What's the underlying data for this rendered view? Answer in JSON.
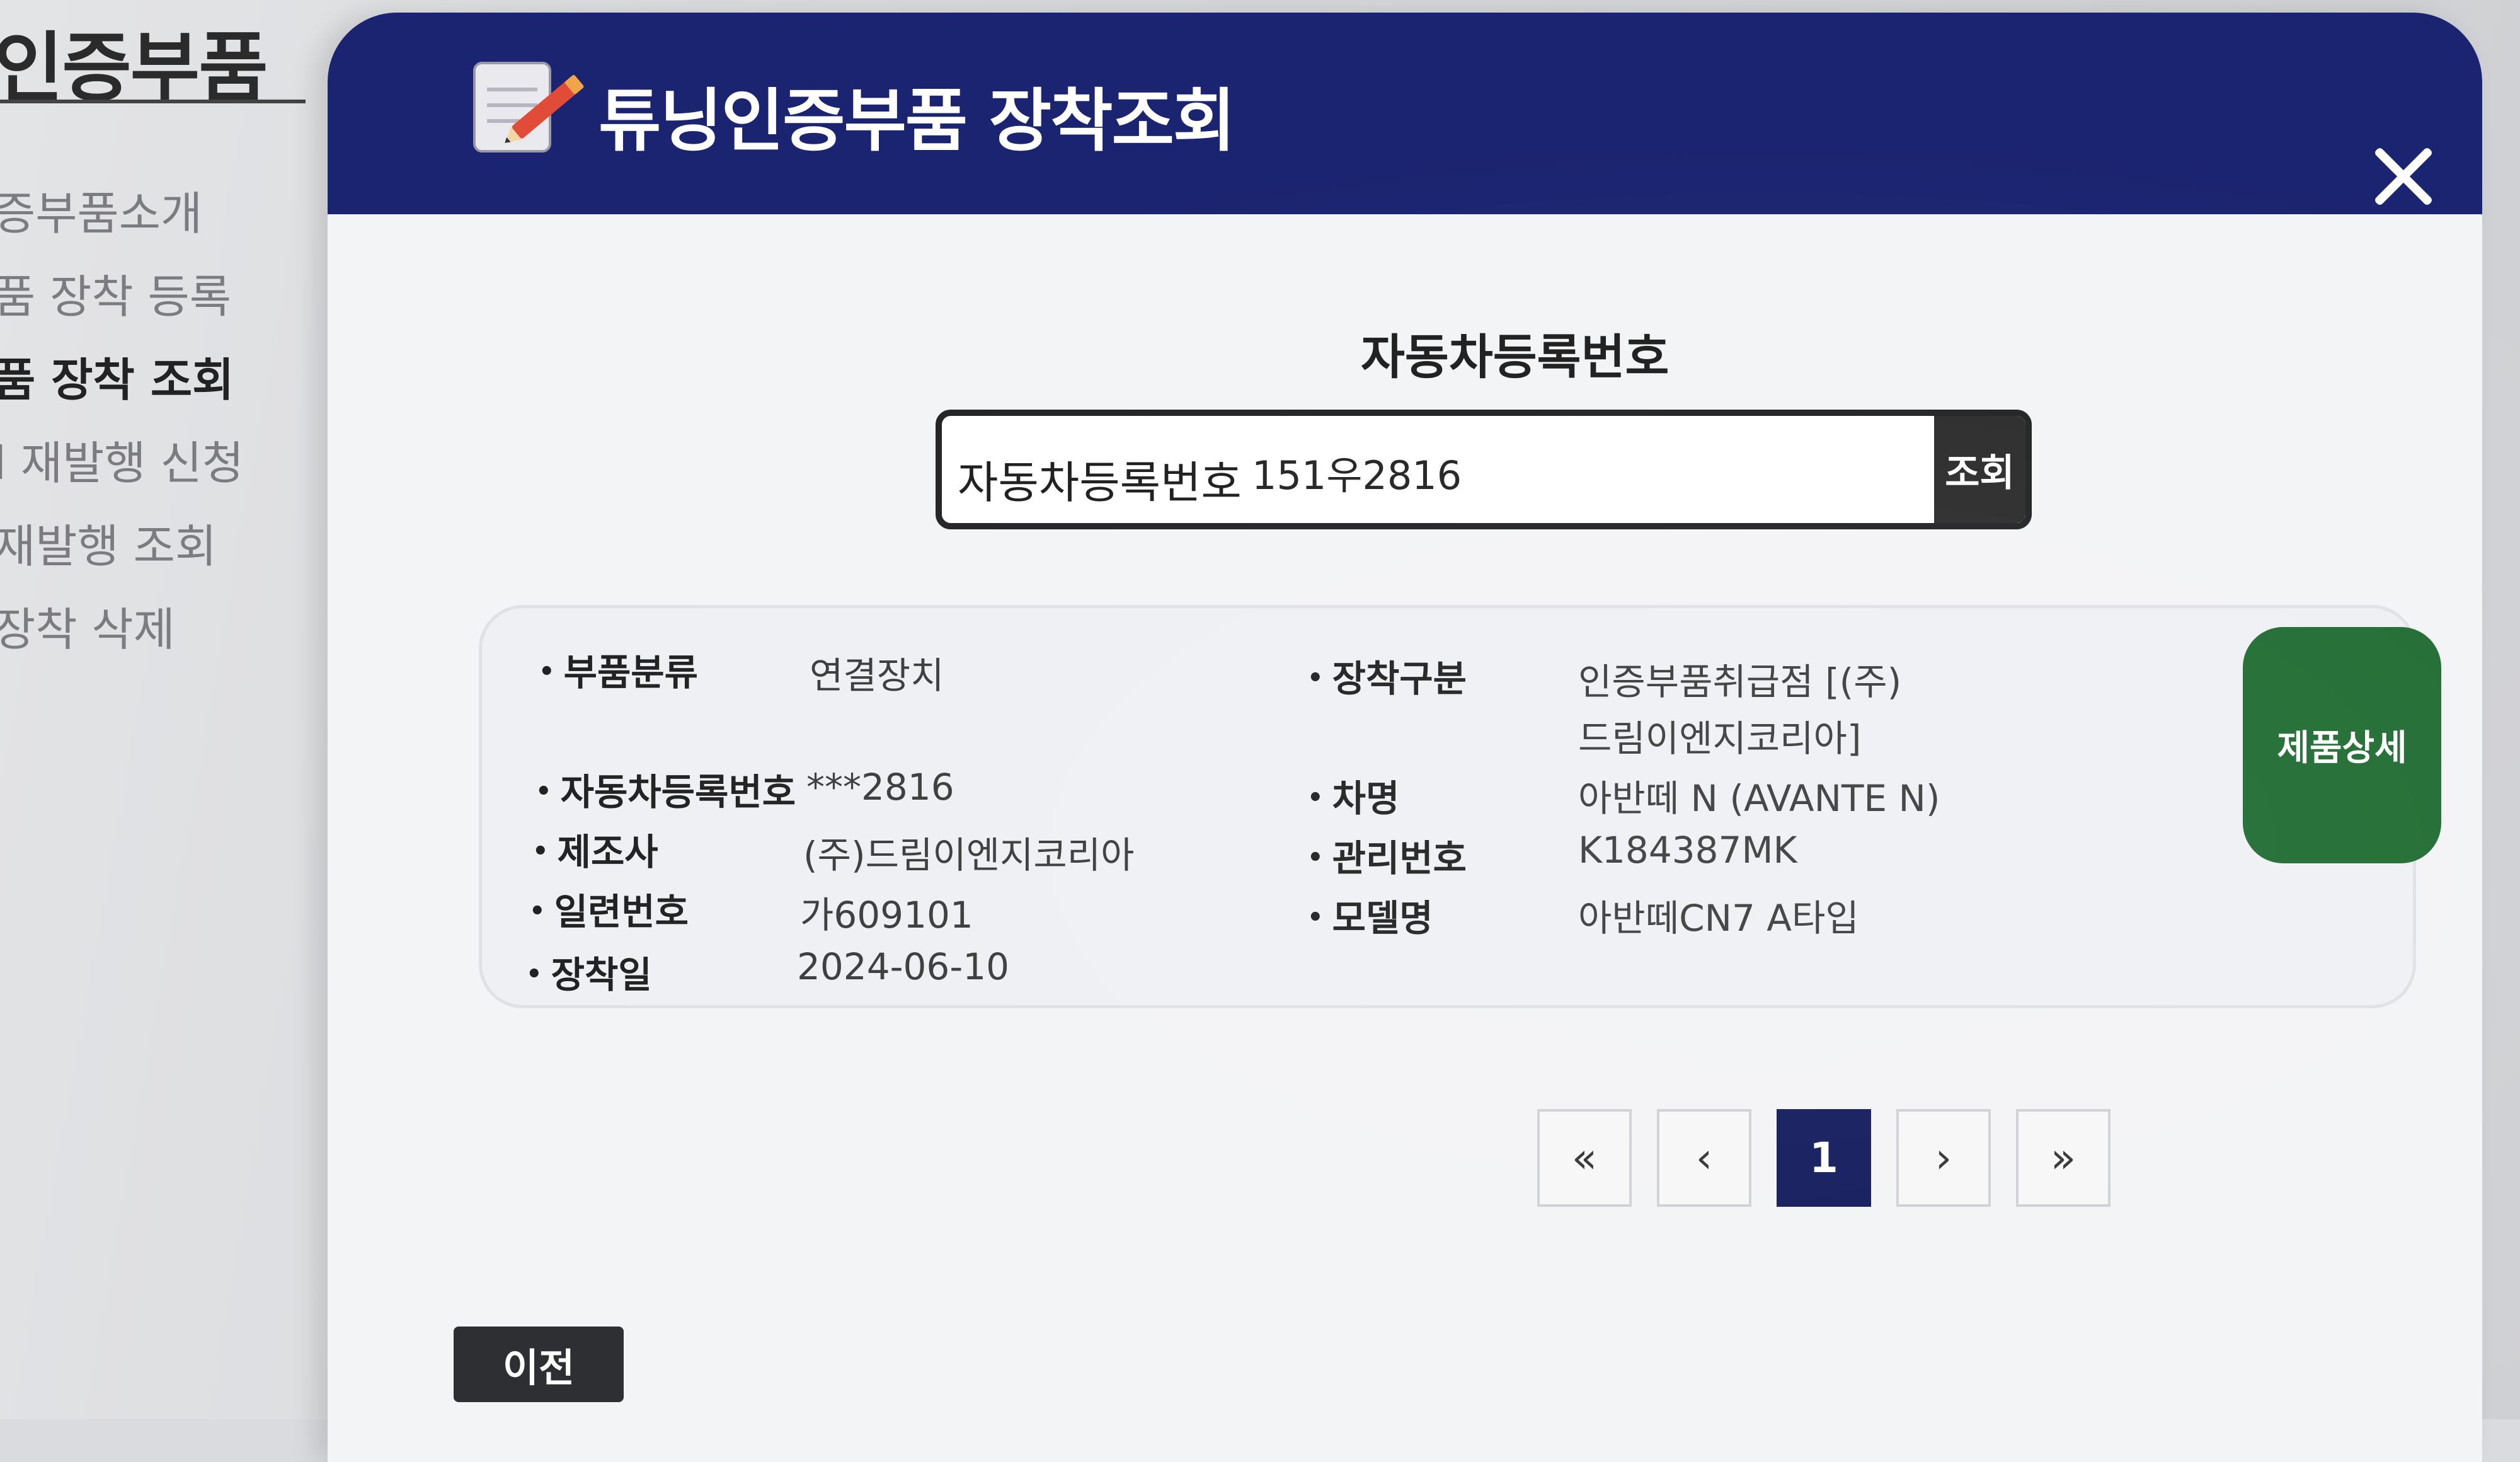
{
  "sidebar": {
    "title": "인증부품",
    "items": [
      {
        "label": "증부품소개"
      },
      {
        "label": "품 장착 등록"
      },
      {
        "label": "품 장착 조회"
      },
      {
        "label": "l 재발행 신청"
      },
      {
        "label": " 재발행 조회"
      },
      {
        "label": "장착 삭제"
      }
    ]
  },
  "modal": {
    "title": "튜닝인증부품 장착조회",
    "icon": "notepad-pencil-icon",
    "close_icon": "close-icon",
    "colors": {
      "header": "#1b2470",
      "detail_button": "#1f6b31",
      "current_page": "#121a5c"
    }
  },
  "search": {
    "section_title": "자동차등록번호",
    "label": "자동차등록번호",
    "value": "151우2816",
    "button_label": "조회"
  },
  "result": {
    "left_fields": [
      {
        "key": "부품분류",
        "value": "연결장치"
      },
      {
        "key": "자동차등록번호",
        "value": "***2816"
      },
      {
        "key": "제조사",
        "value": "(주)드림이엔지코리아"
      },
      {
        "key": "일련번호",
        "value": "가609101"
      },
      {
        "key": "장착일",
        "value": "2024-06-10"
      }
    ],
    "right_fields": [
      {
        "key": "장착구분",
        "value": "인증부품취급점 [(주)",
        "value2": "드림이엔지코리아]"
      },
      {
        "key": "차명",
        "value": "아반떼 N (AVANTE N)"
      },
      {
        "key": "관리번호",
        "value": "K184387MK"
      },
      {
        "key": "모델명",
        "value": "아반떼CN7 A타입"
      }
    ],
    "detail_button_label": "제품상세"
  },
  "pagination": {
    "first": "«",
    "prev": "‹",
    "current": "1",
    "next": "›",
    "last": "»"
  },
  "footer": {
    "prev_button_label": "이전"
  }
}
